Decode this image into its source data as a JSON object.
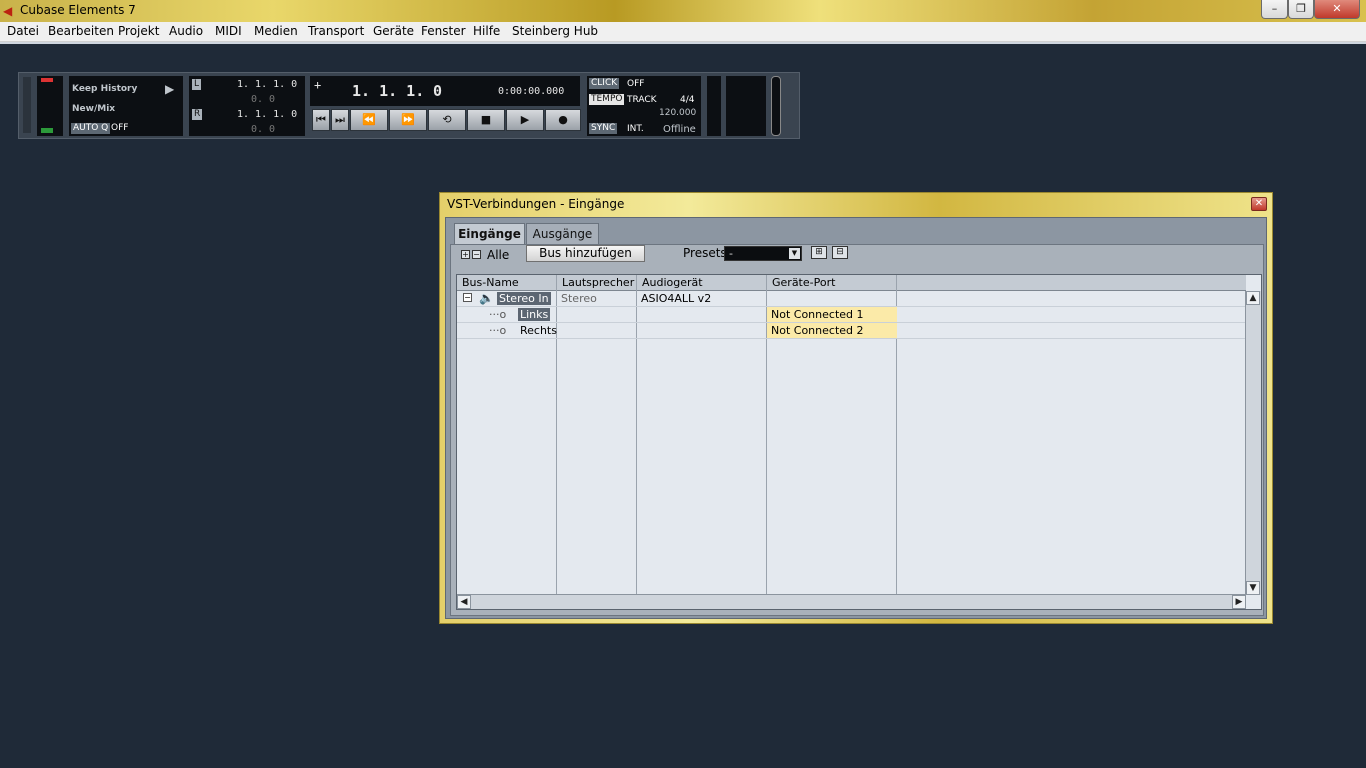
{
  "window": {
    "title": "Cubase Elements 7",
    "controls": {
      "minimize": "–",
      "maximize": "❐",
      "close": "✕"
    }
  },
  "menu": [
    "Datei",
    "Bearbeiten",
    "Projekt",
    "Audio",
    "MIDI",
    "Medien",
    "Transport",
    "Geräte",
    "Fenster",
    "Hilfe",
    "Steinberg Hub"
  ],
  "transport": {
    "history": {
      "line1": "Keep History",
      "line2": "New/Mix",
      "autoq_label": "AUTO Q",
      "autoq_value": "OFF"
    },
    "locators": {
      "L_pos": "1. 1. 1.   0",
      "L_sub": "0.  0",
      "R_pos": "1. 1. 1.   0",
      "R_sub": "0.  0"
    },
    "position": {
      "bars": "1. 1. 1.",
      "ticks": "0",
      "time": "0:00:00.000"
    },
    "click": {
      "label": "CLICK",
      "value": "OFF"
    },
    "tempo": {
      "label": "TEMPO",
      "mode": "TRACK",
      "signature": "4/4",
      "bpm": "120.000"
    },
    "sync": {
      "label": "SYNC",
      "mode": "INT.",
      "status": "Offline"
    },
    "buttons": [
      "⏮",
      "⏭",
      "⏪",
      "⏩",
      "⟲",
      "■",
      "▶",
      "●"
    ]
  },
  "dialog": {
    "title": "VST-Verbindungen - Eingänge",
    "tabs": [
      "Eingänge",
      "Ausgänge"
    ],
    "all_label": "Alle",
    "add_bus": "Bus hinzufügen",
    "presets_label": "Presets",
    "presets_value": "-",
    "columns": [
      "Bus-Name",
      "Lautsprecher",
      "Audiogerät",
      "Geräte-Port"
    ],
    "rows": [
      {
        "name": "Stereo In",
        "speaker": "Stereo",
        "device": "ASIO4ALL v2",
        "port": ""
      },
      {
        "name": "Links",
        "speaker": "",
        "device": "",
        "port": "Not Connected 1"
      },
      {
        "name": "Rechts",
        "speaker": "",
        "device": "",
        "port": "Not Connected 2"
      }
    ]
  }
}
